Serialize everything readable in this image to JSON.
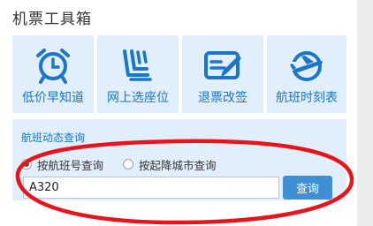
{
  "title": "机票工具箱",
  "tools": [
    {
      "label": "低价早知道",
      "icon": "alarm-clock-icon"
    },
    {
      "label": "网上选座位",
      "icon": "seat-icon"
    },
    {
      "label": "退票改签",
      "icon": "ticket-edit-icon"
    },
    {
      "label": "航班时刻表",
      "icon": "airplane-takeoff-icon"
    }
  ],
  "flight_status": {
    "title": "航班动态查询",
    "options": [
      {
        "label": "按航班号查询",
        "checked": true
      },
      {
        "label": "按起降城市查询",
        "checked": false
      }
    ],
    "input_value": "A320",
    "button_label": "查询"
  },
  "colors": {
    "accent": "#1a76c9",
    "tile_bg": "#e1eefb",
    "button_bg": "#3f8fd6",
    "annotation": "#e8141b"
  }
}
